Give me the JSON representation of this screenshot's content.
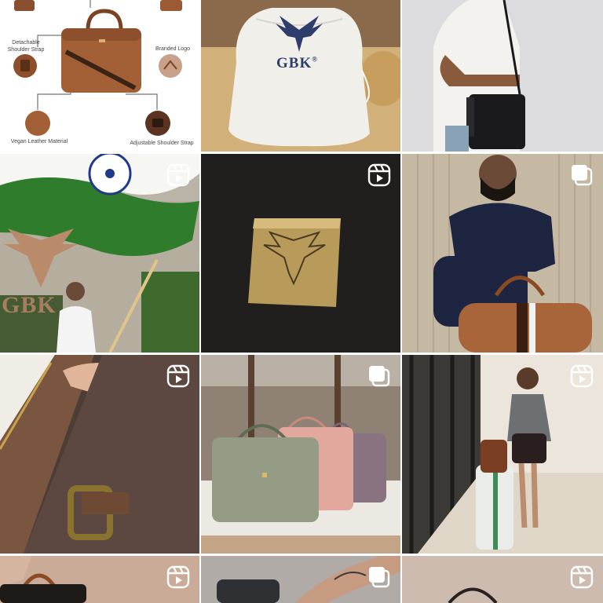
{
  "grid": {
    "tiles": [
      {
        "id": "t1",
        "type": "image"
      },
      {
        "id": "t2",
        "type": "image"
      },
      {
        "id": "t3",
        "type": "image"
      },
      {
        "id": "t4",
        "type": "reel"
      },
      {
        "id": "t5",
        "type": "reel"
      },
      {
        "id": "t6",
        "type": "carousel"
      },
      {
        "id": "t7",
        "type": "reel"
      },
      {
        "id": "t8",
        "type": "carousel"
      },
      {
        "id": "t9",
        "type": "reel"
      },
      {
        "id": "t10",
        "type": "reel"
      },
      {
        "id": "t11",
        "type": "carousel"
      },
      {
        "id": "t12",
        "type": "reel"
      }
    ]
  },
  "infographic": {
    "labels": {
      "strap": "Detachable\nShoulder Strap",
      "logo": "Branded Logo",
      "material": "Vegan Leather Material",
      "adjustable": "Adjustable Shoulder Strap"
    }
  },
  "dustbag": {
    "brand": "GBK",
    "reg": "®"
  },
  "wall_sign": {
    "text": "GBK"
  },
  "icons": {
    "reel": "reel-icon",
    "carousel": "carousel-icon"
  },
  "colors": {
    "badge": "#ffffff",
    "leather_tan": "#9a5a35",
    "navy": "#2e3d6b"
  }
}
